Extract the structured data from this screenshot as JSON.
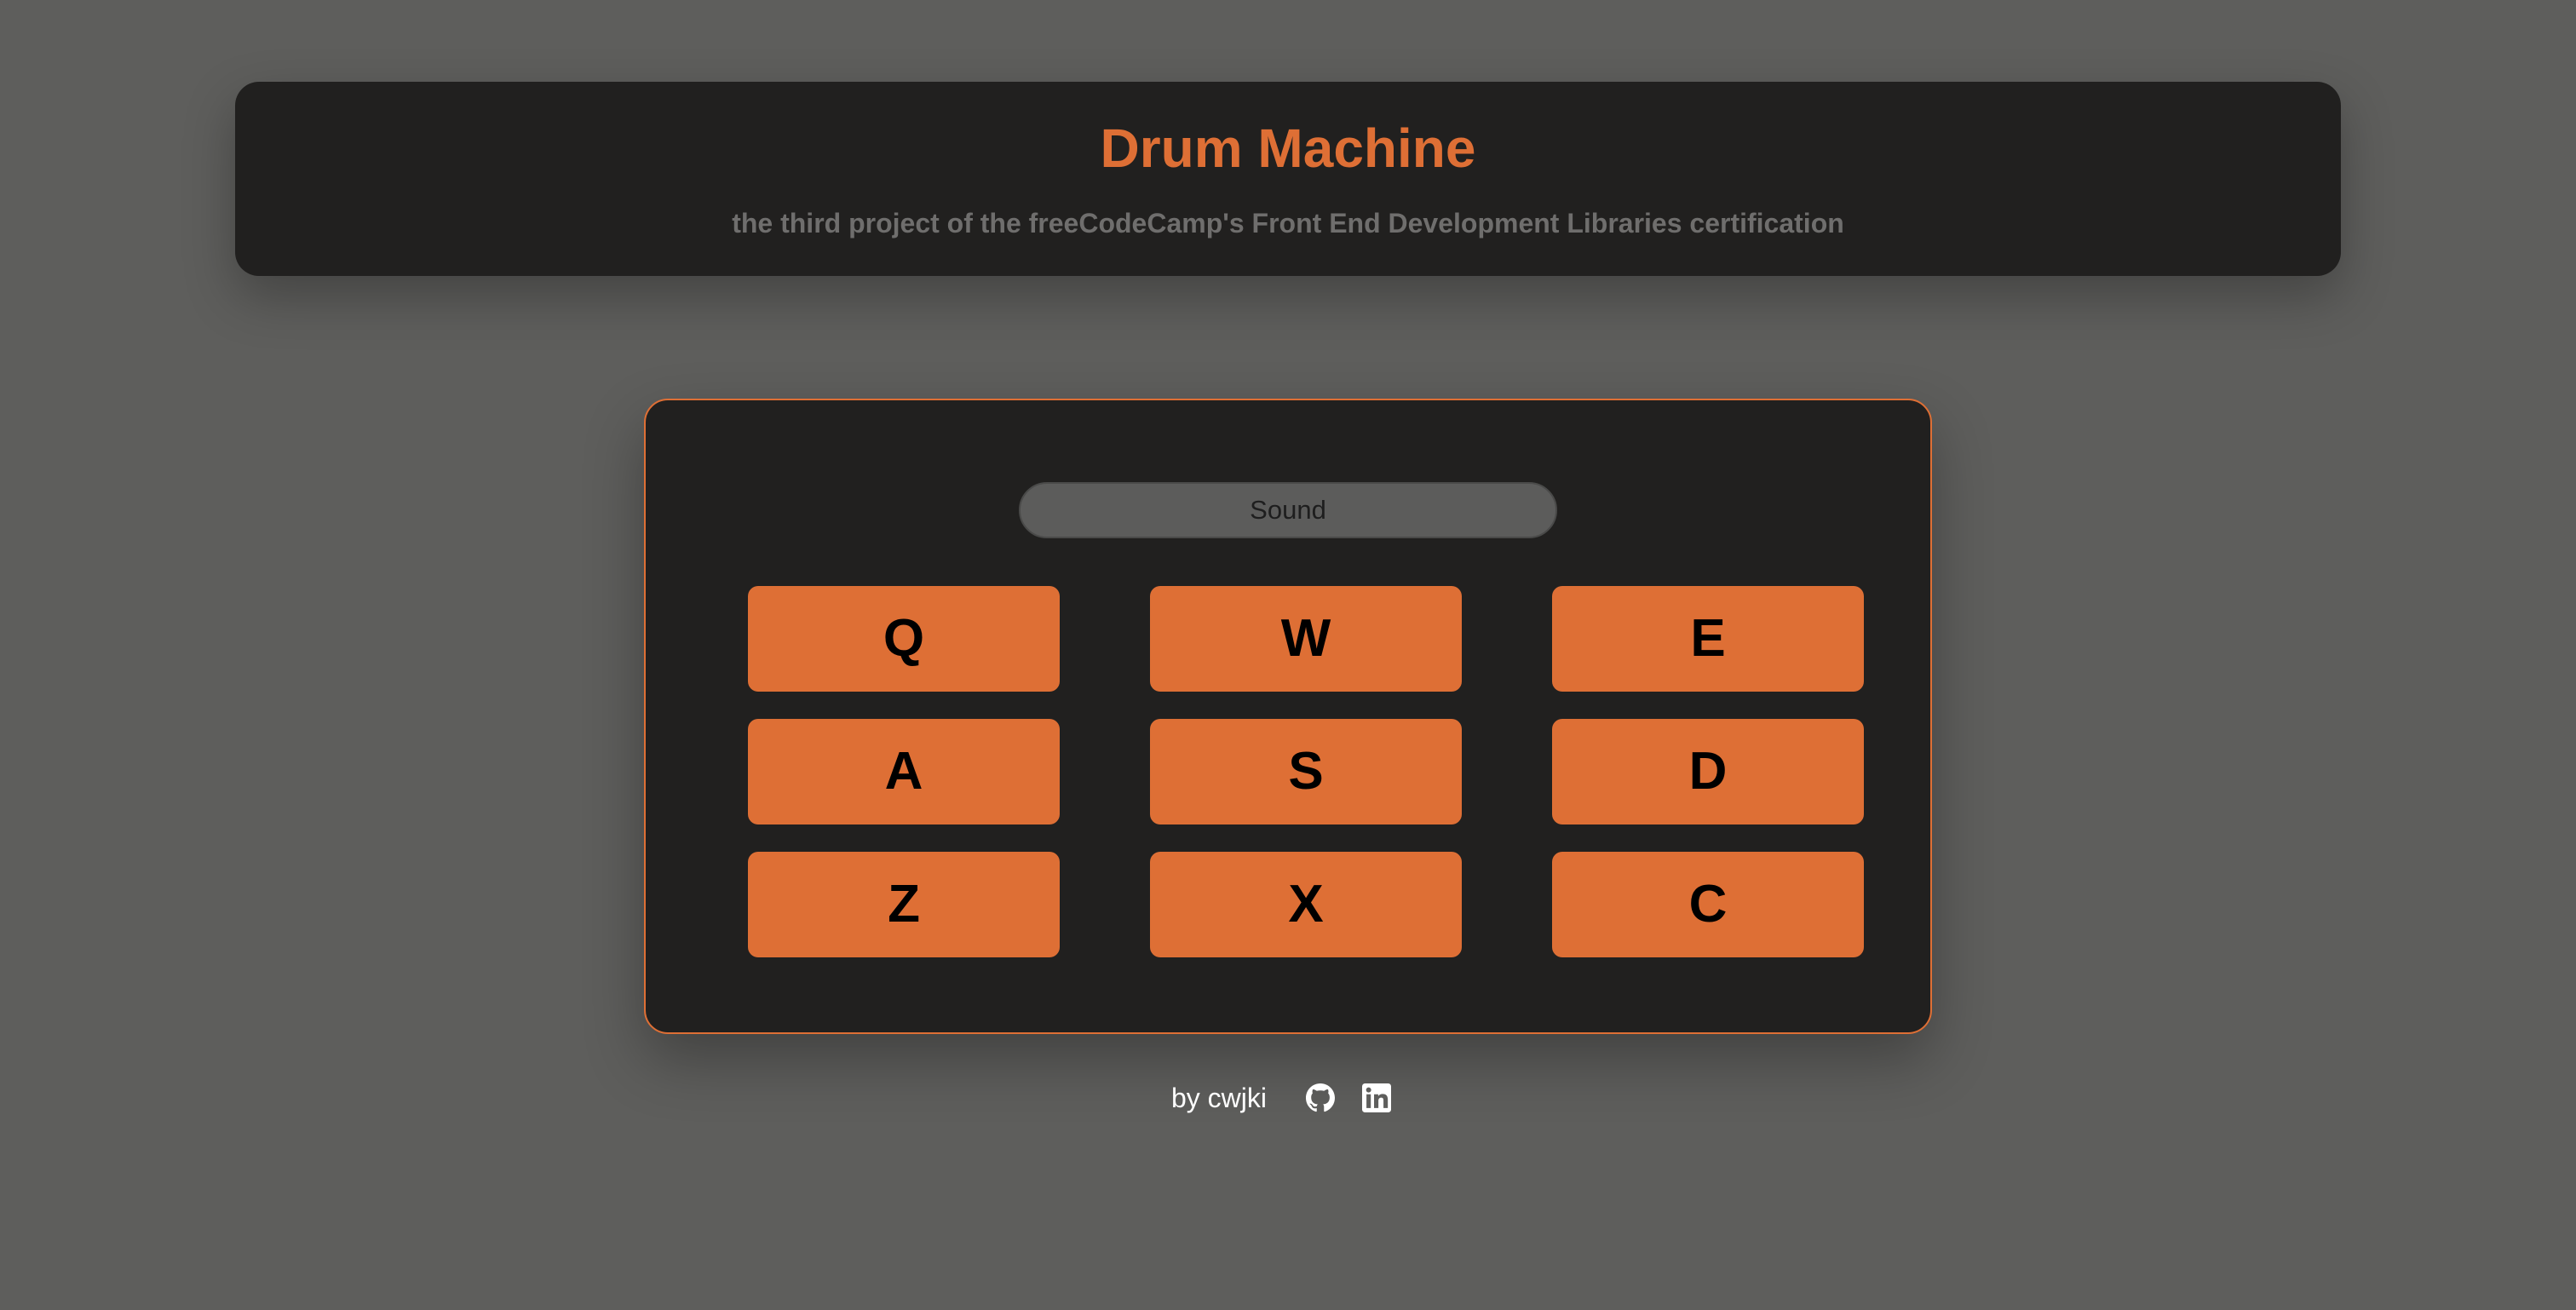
{
  "header": {
    "title": "Drum Machine",
    "subtitle": "the third project of the freeCodeCamp's Front End Development Libraries certification"
  },
  "drum_machine": {
    "display": "Sound",
    "pads": [
      {
        "key": "Q"
      },
      {
        "key": "W"
      },
      {
        "key": "E"
      },
      {
        "key": "A"
      },
      {
        "key": "S"
      },
      {
        "key": "D"
      },
      {
        "key": "Z"
      },
      {
        "key": "X"
      },
      {
        "key": "C"
      }
    ]
  },
  "footer": {
    "byline": "by cwjki",
    "links": [
      {
        "icon": "github-icon"
      },
      {
        "icon": "linkedin-icon"
      }
    ]
  },
  "colors": {
    "accent": "#de6f35",
    "panel": "#21201f",
    "background": "#5e5e5c",
    "subtitle": "#6f6e6d"
  }
}
